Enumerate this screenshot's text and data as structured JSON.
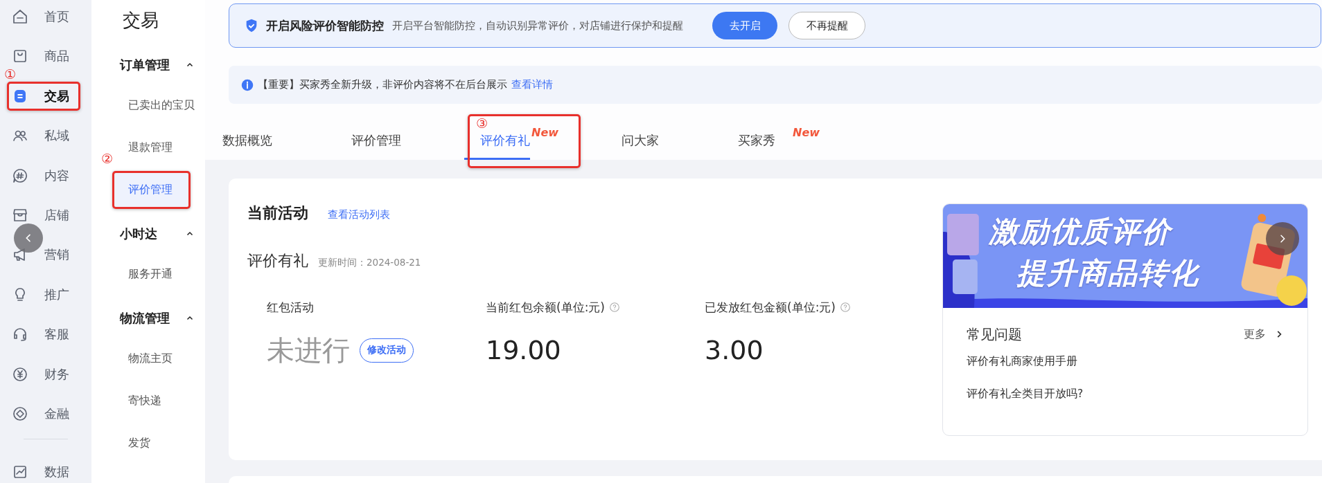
{
  "nav": {
    "items": [
      {
        "label": "首页",
        "selected": false
      },
      {
        "label": "商品",
        "selected": false
      },
      {
        "label": "交易",
        "selected": true,
        "annotation": "①"
      },
      {
        "label": "私域",
        "selected": false
      },
      {
        "label": "内容",
        "selected": false
      },
      {
        "label": "店铺",
        "selected": false
      },
      {
        "label": "营销",
        "selected": false
      },
      {
        "label": "推广",
        "selected": false
      },
      {
        "label": "客服",
        "selected": false
      },
      {
        "label": "财务",
        "selected": false
      },
      {
        "label": "金融",
        "selected": false
      },
      {
        "label": "数据",
        "selected": false,
        "divider_before": true
      }
    ]
  },
  "submenu": {
    "title": "交易",
    "groups": [
      {
        "label": "订单管理",
        "expanded": true,
        "items": [
          {
            "label": "已卖出的宝贝",
            "selected": false
          },
          {
            "label": "退款管理",
            "selected": false
          },
          {
            "label": "评价管理",
            "selected": true,
            "annotation": "②"
          }
        ]
      },
      {
        "label": "小时达",
        "expanded": true,
        "items": [
          {
            "label": "服务开通",
            "selected": false
          }
        ]
      },
      {
        "label": "物流管理",
        "expanded": true,
        "items": [
          {
            "label": "物流主页",
            "selected": false
          },
          {
            "label": "寄快递",
            "selected": false
          },
          {
            "label": "发货",
            "selected": false
          }
        ]
      }
    ]
  },
  "risk_banner": {
    "title": "开启风险评价智能防控",
    "description": "开启平台智能防控，自动识别异常评价，对店铺进行保护和提醒",
    "buttons": [
      {
        "label": "去开启",
        "kind": "primary"
      },
      {
        "label": "不再提醒",
        "kind": "secondary"
      }
    ]
  },
  "notice": {
    "text": "【重要】买家秀全新升级，非评价内容将不在后台展示",
    "link": "查看详情"
  },
  "tabs": [
    {
      "label": "数据概览",
      "selected": false
    },
    {
      "label": "评价管理",
      "selected": false
    },
    {
      "label": "评价有礼",
      "selected": true,
      "badge": "New",
      "annotation": "③"
    },
    {
      "label": "问大家",
      "selected": false
    },
    {
      "label": "买家秀",
      "selected": false,
      "badge": "New"
    }
  ],
  "current_activity": {
    "title": "当前活动",
    "link": "查看活动列表",
    "name": "评价有礼",
    "updated": "更新时间：2024-08-21",
    "stats": [
      {
        "kind": "status",
        "label": "红包活动",
        "value": "未进行",
        "action": "修改活动",
        "help": false
      },
      {
        "kind": "amount",
        "label": "当前红包余额(单位:元)",
        "value": "19.00",
        "help": true
      },
      {
        "kind": "amount",
        "label": "已发放红包金额(单位:元)",
        "value": "3.00",
        "help": true
      }
    ]
  },
  "side_panel": {
    "banner": {
      "lines": [
        "激励优质评价",
        "提升商品转化"
      ]
    },
    "faq": {
      "title": "常见问题",
      "more": "更多",
      "items": [
        "评价有礼商家使用手册",
        "评价有礼全类目开放吗?"
      ]
    }
  }
}
